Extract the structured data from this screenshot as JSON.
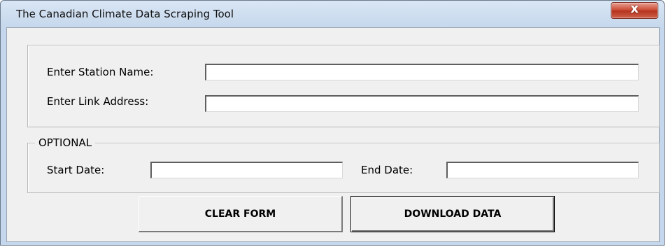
{
  "window": {
    "title": "The Canadian Climate Data Scraping Tool",
    "close_glyph": "x"
  },
  "form": {
    "station_name": {
      "label": "Enter Station Name:",
      "value": ""
    },
    "link_address": {
      "label": "Enter Link Address:",
      "value": ""
    }
  },
  "optional": {
    "legend": "OPTIONAL",
    "start_date": {
      "label": "Start Date:",
      "value": ""
    },
    "end_date": {
      "label": "End Date:",
      "value": ""
    }
  },
  "buttons": {
    "clear_form": "CLEAR FORM",
    "download_data": "DOWNLOAD DATA"
  },
  "colors": {
    "titlebar": "#c5d7ec",
    "close_button": "#c9462f",
    "client_bg": "#f0f0f0"
  }
}
